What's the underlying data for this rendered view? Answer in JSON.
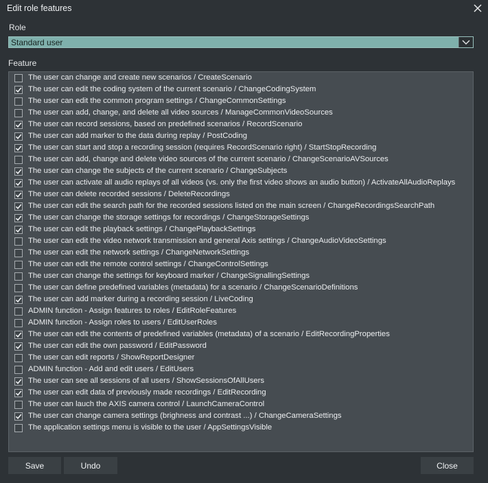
{
  "window": {
    "title": "Edit role features"
  },
  "role": {
    "label": "Role",
    "selected": "Standard user"
  },
  "feature_section": {
    "label": "Feature",
    "items": [
      {
        "label": "The user can change and create new scenarios / CreateScenario",
        "checked": false
      },
      {
        "label": "The user can edit the coding system of the current scenario / ChangeCodingSystem",
        "checked": true
      },
      {
        "label": "The user can edit the common program settings / ChangeCommonSettings",
        "checked": false
      },
      {
        "label": "The user can add, change, and delete all video sources / ManageCommonVideoSources",
        "checked": false
      },
      {
        "label": "The user can record sessions, based on predefined scenarios / RecordScenario",
        "checked": true
      },
      {
        "label": "The user can add marker to the data during replay / PostCoding",
        "checked": true
      },
      {
        "label": "The user can start and stop a recording session (requires RecordScenario right) / StartStopRecording",
        "checked": true
      },
      {
        "label": "The user can add, change and delete video sources of the current scenario / ChangeScenarioAVSources",
        "checked": false
      },
      {
        "label": "The user can change the subjects of the current scenario / ChangeSubjects",
        "checked": true
      },
      {
        "label": "The user can activate all audio replays of all videos (vs. only the first video shows an audio button) / ActivateAllAudioReplays",
        "checked": true
      },
      {
        "label": "The user can delete recorded sessions / DeleteRecordings",
        "checked": true
      },
      {
        "label": "The user can edit the search path for the recorded sessions listed on the main screen / ChangeRecordingsSearchPath",
        "checked": true
      },
      {
        "label": "The user can change the storage settings for recordings / ChangeStorageSettings",
        "checked": true
      },
      {
        "label": "The user can edit the playback settings / ChangePlaybackSettings",
        "checked": true
      },
      {
        "label": "The user can edit the video network transmission and general Axis settings / ChangeAudioVideoSettings",
        "checked": false
      },
      {
        "label": "The user can edit the network settings / ChangeNetworkSettings",
        "checked": false
      },
      {
        "label": "The user can edit the remote control settings / ChangeControlSettings",
        "checked": false
      },
      {
        "label": "The user can change the settings for keyboard marker / ChangeSignallingSettings",
        "checked": false
      },
      {
        "label": "The user can define predefined variables (metadata) for a scenario / ChangeScenarioDefinitions",
        "checked": false
      },
      {
        "label": "The user can add marker during a recording session / LiveCoding",
        "checked": true
      },
      {
        "label": "ADMIN function - Assign features to roles / EditRoleFeatures",
        "checked": false
      },
      {
        "label": "ADMIN function - Assign roles to users / EditUserRoles",
        "checked": false
      },
      {
        "label": "The user can edit the contents of predefined variables  (metadata) of a scenario / EditRecordingProperties",
        "checked": true
      },
      {
        "label": "The user can edit the own password / EditPassword",
        "checked": true
      },
      {
        "label": "The user can edit reports / ShowReportDesigner",
        "checked": false
      },
      {
        "label": "ADMIN function - Add and edit users / EditUsers",
        "checked": false
      },
      {
        "label": "The user can see all sessions of all users / ShowSessionsOfAllUsers",
        "checked": true
      },
      {
        "label": "The user can edit data of previously made recordings / EditRecording",
        "checked": true
      },
      {
        "label": "The user can lauch the AXIS camera control / LaunchCameraControl",
        "checked": false
      },
      {
        "label": "The user can change camera settings (brighness and contrast ...) / ChangeCameraSettings",
        "checked": true
      },
      {
        "label": "The application settings menu is visible to the user / AppSettingsVisible",
        "checked": false
      }
    ]
  },
  "buttons": {
    "save": "Save",
    "undo": "Undo",
    "close": "Close"
  },
  "icons": {
    "close": "close-icon",
    "dropdown": "chevron-down-icon",
    "check": "check-icon"
  },
  "colors": {
    "background": "#2d3236",
    "panel": "#464c51",
    "select_highlight": "#7fb0ac",
    "button": "#3a4044"
  }
}
